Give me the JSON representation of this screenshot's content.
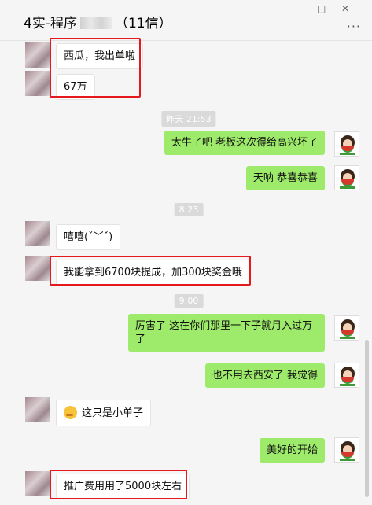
{
  "header": {
    "title_prefix": "4实-程序",
    "title_suffix": "（11信）",
    "minimize": "—",
    "maximize": "□",
    "close": "✕",
    "more": "···"
  },
  "timestamps": [
    "昨天 21:53",
    "8:23",
    "9:00"
  ],
  "messages": [
    {
      "side": "in",
      "text": "西瓜，我出单啦"
    },
    {
      "side": "in",
      "text": "67万"
    },
    {
      "side": "out",
      "text": "太牛了吧  老板这次得给高兴坏了"
    },
    {
      "side": "out",
      "text": "天呐  恭喜恭喜"
    },
    {
      "side": "in",
      "text": "嘻嘻(ˇ﹀ˇ)"
    },
    {
      "side": "in",
      "text": "我能拿到6700块提成，加300块奖金哦"
    },
    {
      "side": "out",
      "text": "厉害了   这在你们那里一下子就月入过万了"
    },
    {
      "side": "out",
      "text": "也不用去西安了  我觉得"
    },
    {
      "side": "in",
      "text": "这只是小单子",
      "icon": "embarrassed-emoji-icon"
    },
    {
      "side": "out",
      "text": "美好的开始"
    },
    {
      "side": "in",
      "text": "推广费用用了5000块左右"
    }
  ],
  "highlight_color": "#e5181b",
  "bubble_out_color": "#9eea6a"
}
